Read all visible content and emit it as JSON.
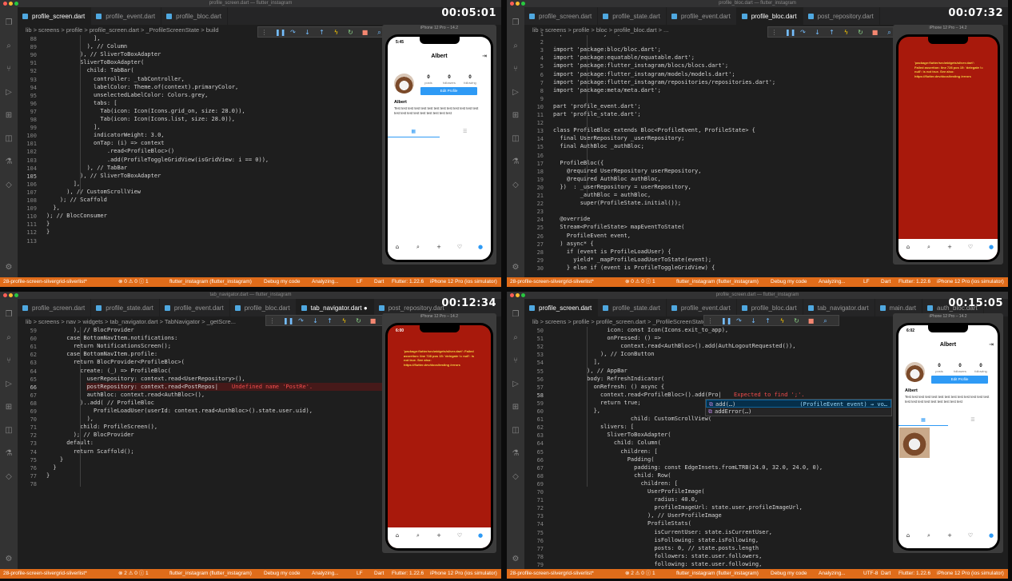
{
  "colors": {
    "statusbar": "#e06c1a",
    "editor_bg": "#1e1e1e",
    "error_screen": "#a8190c",
    "accent_blue": "#2e9af5"
  },
  "panels": [
    {
      "window_title": "profile_screen.dart — flutter_instagram",
      "timestamp": "00:05:01",
      "tabs": [
        {
          "label": "profile_screen.dart",
          "active": true,
          "icon": "dart-file-icon"
        },
        {
          "label": "profile_event.dart",
          "active": false,
          "icon": "dart-file-icon"
        },
        {
          "label": "profile_bloc.dart",
          "active": false,
          "icon": "dart-file-icon"
        }
      ],
      "breadcrumb": "lib > screens > profile > profile_screen.dart > _ProfileScreenState > build",
      "current_line": "105",
      "lines": [
        {
          "n": "88",
          "t": "              ],"
        },
        {
          "n": "89",
          "t": "            ), // Column"
        },
        {
          "n": "90",
          "t": "          ), // SliverToBoxAdapter"
        },
        {
          "n": "91",
          "t": "          SliverToBoxAdapter("
        },
        {
          "n": "92",
          "t": "            child: TabBar("
        },
        {
          "n": "93",
          "t": "              controller: _tabController,"
        },
        {
          "n": "94",
          "t": "              labelColor: Theme.of(context).primaryColor,"
        },
        {
          "n": "95",
          "t": "              unselectedLabelColor: Colors.grey,"
        },
        {
          "n": "96",
          "t": "              tabs: ["
        },
        {
          "n": "97",
          "t": "                Tab(icon: Icon(Icons.grid_on, size: 28.0)),"
        },
        {
          "n": "98",
          "t": "                Tab(icon: Icon(Icons.list, size: 28.0)),"
        },
        {
          "n": "99",
          "t": "              ],"
        },
        {
          "n": "100",
          "t": "              indicatorWeight: 3.0,"
        },
        {
          "n": "101",
          "t": "              onTap: (i) => context"
        },
        {
          "n": "102",
          "t": "                  .read<ProfileBloc>()"
        },
        {
          "n": "103",
          "t": "                  .add(ProfileToggleGridView(isGridView: i == 0)),"
        },
        {
          "n": "104",
          "t": "            ), // TabBar"
        },
        {
          "n": "105",
          "t": "          ), // SliverToBoxAdapter"
        },
        {
          "n": "106",
          "t": "        ],"
        },
        {
          "n": "107",
          "t": "      ), // CustomScrollView"
        },
        {
          "n": "108",
          "t": "    ); // Scaffold"
        },
        {
          "n": "109",
          "t": "  },"
        },
        {
          "n": "110",
          "t": "); // BlocConsumer"
        },
        {
          "n": "111",
          "t": "}"
        },
        {
          "n": "112",
          "t": "}"
        },
        {
          "n": "113",
          "t": ""
        }
      ],
      "status": {
        "branch": "28-profile-screen-slivergrid-sliverlist*",
        "problems": "⊗ 0 ⚠ 0 ⓘ 1",
        "project": "flutter_instagram (flutter_instagram)",
        "debug": "Debug my code",
        "analyzing": "Analyzing...",
        "eol": "LF",
        "lang": "Dart",
        "flutter": "Flutter: 1.22.6",
        "device": "iPhone 12 Pro (ios simulator)"
      },
      "simulator": {
        "title": "iPhone 12 Pro – 14.2",
        "phone_time": "5:45",
        "kind": "profile",
        "appbar_title": "Albert",
        "posts_label": "posts",
        "posts_value": "0",
        "followers_label": "followers",
        "followers_value": "0",
        "following_label": "following",
        "following_value": "0",
        "edit_button": "Edit Profile",
        "username": "Albert",
        "bio": "Test test test test test test test test test test test test test test test test test test test test test test",
        "show_grid_image": false
      }
    },
    {
      "window_title": "profile_bloc.dart — flutter_instagram",
      "timestamp": "00:07:32",
      "tabs": [
        {
          "label": "profile_screen.dart",
          "active": false,
          "icon": "dart-file-icon"
        },
        {
          "label": "profile_state.dart",
          "active": false,
          "icon": "dart-file-icon"
        },
        {
          "label": "profile_event.dart",
          "active": false,
          "icon": "dart-file-icon"
        },
        {
          "label": "profile_bloc.dart",
          "active": true,
          "icon": "dart-file-icon"
        },
        {
          "label": "post_repository.dart",
          "active": false,
          "icon": "dart-file-icon"
        }
      ],
      "breadcrumb": "lib > screens > profile > bloc > profile_bloc.dart > ...",
      "current_line": "",
      "lines": [
        {
          "n": "1",
          "t": "import 'dart:async';"
        },
        {
          "n": "2",
          "t": ""
        },
        {
          "n": "3",
          "t": "import 'package:bloc/bloc.dart';"
        },
        {
          "n": "4",
          "t": "import 'package:equatable/equatable.dart';"
        },
        {
          "n": "5",
          "t": "import 'package:flutter_instagram/blocs/blocs.dart';"
        },
        {
          "n": "6",
          "t": "import 'package:flutter_instagram/models/models.dart';"
        },
        {
          "n": "7",
          "t": "import 'package:flutter_instagram/repositories/repositories.dart';"
        },
        {
          "n": "8",
          "t": "import 'package:meta/meta.dart';"
        },
        {
          "n": "9",
          "t": ""
        },
        {
          "n": "10",
          "t": "part 'profile_event.dart';"
        },
        {
          "n": "11",
          "t": "part 'profile_state.dart';"
        },
        {
          "n": "12",
          "t": ""
        },
        {
          "n": "13",
          "t": "class ProfileBloc extends Bloc<ProfileEvent, ProfileState> {"
        },
        {
          "n": "14",
          "t": "  final UserRepository _userRepository;"
        },
        {
          "n": "15",
          "t": "  final AuthBloc _authBloc;"
        },
        {
          "n": "16",
          "t": ""
        },
        {
          "n": "17",
          "t": "  ProfileBloc({"
        },
        {
          "n": "18",
          "t": "    @required UserRepository userRepository,"
        },
        {
          "n": "19",
          "t": "    @required AuthBloc authBloc,"
        },
        {
          "n": "20",
          "t": "  })  : _userRepository = userRepository,"
        },
        {
          "n": "21",
          "t": "        _authBloc = authBloc,"
        },
        {
          "n": "22",
          "t": "        super(ProfileState.initial());"
        },
        {
          "n": "23",
          "t": ""
        },
        {
          "n": "24",
          "t": "  @override"
        },
        {
          "n": "25",
          "t": "  Stream<ProfileState> mapEventToState("
        },
        {
          "n": "26",
          "t": "    ProfileEvent event,"
        },
        {
          "n": "27",
          "t": "  ) async* {"
        },
        {
          "n": "28",
          "t": "    if (event is ProfileLoadUser) {"
        },
        {
          "n": "29",
          "t": "      yield* _mapProfileLoadUserToState(event);"
        },
        {
          "n": "30",
          "t": "    } else if (event is ProfileToggleGridView) {"
        }
      ],
      "status": {
        "branch": "28-profile-screen-slivergrid-sliverlist*",
        "problems": "⊗ 0 ⚠ 0 ⓘ 1",
        "project": "flutter_instagram (flutter_instagram)",
        "debug": "Debug my code",
        "analyzing": "Analyzing...",
        "eol": "LF",
        "lang": "Dart",
        "flutter": "Flutter: 1.22.6",
        "device": "iPhone 12 Pro (ios simulator)"
      },
      "simulator": {
        "title": "iPhone 12 Pro – 14.2",
        "phone_time": "",
        "kind": "error",
        "error_text": "'package:flutter/src/widgets/sliver.dart': Failed assertion: line 728 pos 15: 'delegate != null': is not true. See also: https://flutter.dev/docs/testing /errors"
      }
    },
    {
      "window_title": "tab_navigator.dart — flutter_instagram",
      "timestamp": "00:12:34",
      "tabs": [
        {
          "label": "profile_screen.dart",
          "active": false,
          "icon": "dart-file-icon"
        },
        {
          "label": "profile_state.dart",
          "active": false,
          "icon": "dart-file-icon"
        },
        {
          "label": "profile_event.dart",
          "active": false,
          "icon": "dart-file-icon"
        },
        {
          "label": "profile_bloc.dart",
          "active": false,
          "icon": "dart-file-icon"
        },
        {
          "label": "tab_navigator.dart ●",
          "active": true,
          "icon": "dart-file-icon"
        },
        {
          "label": "post_repository.dart",
          "active": false,
          "icon": "dart-file-icon"
        }
      ],
      "breadcrumb": "lib > screens > nav > widgets > tab_navigator.dart > TabNavigator > _getScre...",
      "current_line": "66",
      "error_line_index": 7,
      "lines": [
        {
          "n": "59",
          "t": "        ), // BlocProvider"
        },
        {
          "n": "60",
          "t": "      case BottomNavItem.notifications:"
        },
        {
          "n": "61",
          "t": "        return NotificationsScreen();"
        },
        {
          "n": "62",
          "t": "      case BottomNavItem.profile:"
        },
        {
          "n": "63",
          "t": "        return BlocProvider<ProfileBloc>("
        },
        {
          "n": "64",
          "t": "          create: (_) => ProfileBloc("
        },
        {
          "n": "65",
          "t": "            userRepository: context.read<UserRepository>(),"
        },
        {
          "n": "66",
          "t": "            postRepository: context.read<PostRepos|"
        },
        {
          "n": "67",
          "t": "            authBloc: context.read<AuthBloc>(),"
        },
        {
          "n": "68",
          "t": "          )..add( // ProfileBloc"
        },
        {
          "n": "69",
          "t": "              ProfileLoadUser(userId: context.read<AuthBloc>().state.user.uid),"
        },
        {
          "n": "70",
          "t": "            ),"
        },
        {
          "n": "71",
          "t": "          child: ProfileScreen(),"
        },
        {
          "n": "72",
          "t": "        ); // BlocProvider"
        },
        {
          "n": "73",
          "t": "      default:"
        },
        {
          "n": "74",
          "t": "        return Scaffold();"
        },
        {
          "n": "75",
          "t": "    }"
        },
        {
          "n": "76",
          "t": "  }"
        },
        {
          "n": "77",
          "t": "}"
        },
        {
          "n": "78",
          "t": ""
        }
      ],
      "inline_error": "Undefined name 'PostRe'.",
      "status": {
        "branch": "28-profile-screen-slivergrid-sliverlist*",
        "problems": "⊗ 2 ⚠ 0 ⓘ 1",
        "project": "flutter_instagram (flutter_instagram)",
        "debug": "Debug my code",
        "analyzing": "Analyzing...",
        "eol": "LF",
        "lang": "Dart",
        "flutter": "Flutter: 1.22.6",
        "device": "iPhone 12 Pro (ios simulator)"
      },
      "simulator": {
        "title": "iPhone 12 Pro – 14.2",
        "phone_time": "6:00",
        "kind": "error",
        "error_text": "'package:flutter/src/widgets/sliver.dart': Failed assertion: line 728 pos 15: 'delegate != null': is not true. See also: https://flutter.dev/docs/testing /errors"
      }
    },
    {
      "window_title": "profile_screen.dart — flutter_instagram",
      "timestamp": "00:15:05",
      "tabs": [
        {
          "label": "profile_screen.dart",
          "active": true,
          "icon": "dart-file-icon"
        },
        {
          "label": "profile_state.dart",
          "active": false,
          "icon": "dart-file-icon"
        },
        {
          "label": "profile_event.dart",
          "active": false,
          "icon": "dart-file-icon"
        },
        {
          "label": "profile_bloc.dart",
          "active": false,
          "icon": "dart-file-icon"
        },
        {
          "label": "tab_navigator.dart",
          "active": false,
          "icon": "dart-file-icon"
        },
        {
          "label": "main.dart",
          "active": false,
          "icon": "dart-file-icon"
        },
        {
          "label": "auth_bloc.dart",
          "active": false,
          "icon": "dart-file-icon"
        }
      ],
      "breadcrumb": "lib > screens > profile > profile_screen.dart > _ProfileScreenState > build",
      "current_line": "58",
      "lines": [
        {
          "n": "50",
          "t": "                icon: const Icon(Icons.exit_to_app),"
        },
        {
          "n": "51",
          "t": "                onPressed: () =>"
        },
        {
          "n": "52",
          "t": "                    context.read<AuthBloc>().add(AuthLogoutRequested()),"
        },
        {
          "n": "53",
          "t": "              ), // IconButton"
        },
        {
          "n": "54",
          "t": "            ],"
        },
        {
          "n": "55",
          "t": "          ), // AppBar"
        },
        {
          "n": "56",
          "t": "          body: RefreshIndicator("
        },
        {
          "n": "57",
          "t": "            onRefresh: () async {"
        },
        {
          "n": "58",
          "t": "              context.read<ProfileBloc>().add(Pro|"
        },
        {
          "n": "59",
          "t": "              return true;"
        },
        {
          "n": "60",
          "t": "            },"
        },
        {
          "n": "61",
          "t": "                       child: CustomScrollView("
        },
        {
          "n": "62",
          "t": "              slivers: ["
        },
        {
          "n": "63",
          "t": "                SliverToBoxAdapter("
        },
        {
          "n": "64",
          "t": "                  child: Column("
        },
        {
          "n": "65",
          "t": "                    children: ["
        },
        {
          "n": "66",
          "t": "                      Padding("
        },
        {
          "n": "67",
          "t": "                        padding: const EdgeInsets.fromLTRB(24.0, 32.0, 24.0, 0),"
        },
        {
          "n": "68",
          "t": "                        child: Row("
        },
        {
          "n": "69",
          "t": "                          children: ["
        },
        {
          "n": "70",
          "t": "                            UserProfileImage("
        },
        {
          "n": "71",
          "t": "                              radius: 40.0,"
        },
        {
          "n": "72",
          "t": "                              profileImageUrl: state.user.profileImageUrl,"
        },
        {
          "n": "73",
          "t": "                            ), // UserProfileImage"
        },
        {
          "n": "74",
          "t": "                            ProfileStats("
        },
        {
          "n": "75",
          "t": "                              isCurrentUser: state.isCurrentUser,"
        },
        {
          "n": "76",
          "t": "                              isFollowing: state.isFollowing,"
        },
        {
          "n": "77",
          "t": "                              posts: 0, // state.posts.length"
        },
        {
          "n": "78",
          "t": "                              followers: state.user.followers,"
        },
        {
          "n": "79",
          "t": "                              following: state.user.following,"
        }
      ],
      "inline_error": "Expected to find ';'.",
      "suggestions": [
        {
          "label": "add(…)",
          "detail": "(ProfileEvent event) → vo…",
          "selected": true
        },
        {
          "label": "addError(…)",
          "detail": "",
          "selected": false
        }
      ],
      "status": {
        "branch": "28-profile-screen-slivergrid-sliverlist*",
        "problems": "⊗ 2 ⚠ 0 ⓘ 1",
        "project": "flutter_instagram (flutter_instagram)",
        "debug": "Debug my code",
        "analyzing": "Analyzing...",
        "eol": "UTF-8",
        "lang": "Dart",
        "flutter": "Flutter: 1.22.6",
        "device": "iPhone 12 Pro (ios simulator)"
      },
      "simulator": {
        "title": "iPhone 12 Pro – 14.2",
        "phone_time": "6:02",
        "kind": "profile",
        "appbar_title": "Albert",
        "posts_label": "posts",
        "posts_value": "0",
        "followers_label": "followers",
        "followers_value": "0",
        "following_label": "following",
        "following_value": "0",
        "edit_button": "Edit Profile",
        "username": "Albert",
        "bio": "Test test test test test test test test test test test test test test test test test test test test test test",
        "show_grid_image": true
      }
    }
  ]
}
